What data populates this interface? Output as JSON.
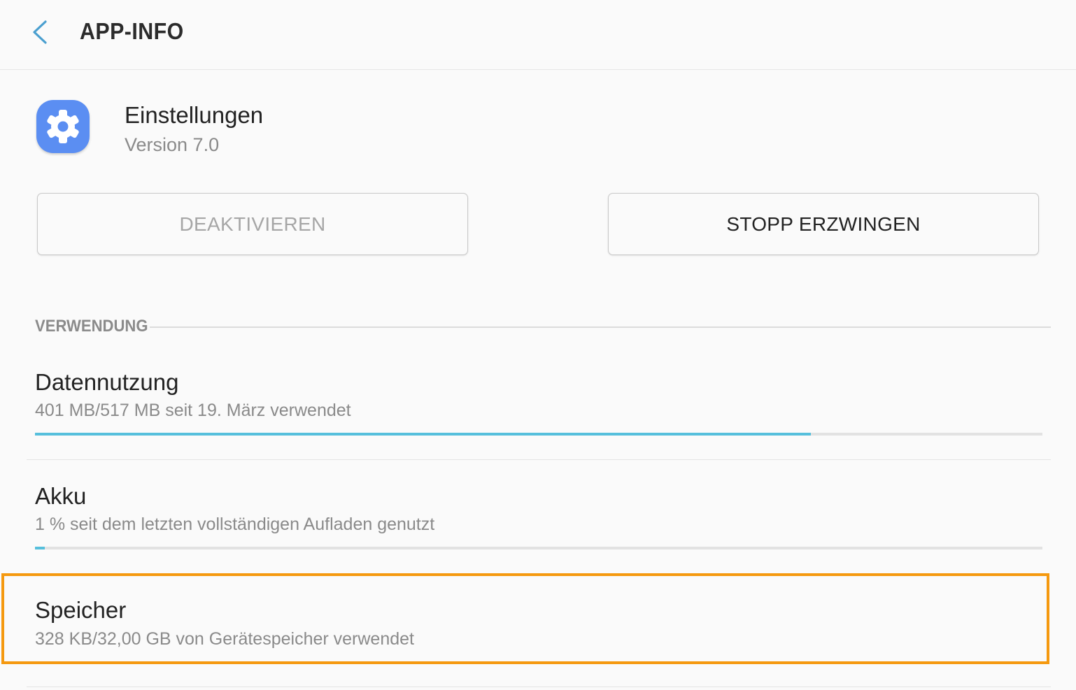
{
  "header": {
    "title": "APP-INFO",
    "back_icon": "chevron-left-icon",
    "accent": "#4a9fcf"
  },
  "app": {
    "name": "Einstellungen",
    "version": "Version 7.0",
    "icon": "gear-icon",
    "icon_color": "#5b8ef2"
  },
  "buttons": {
    "disable_label": "DEAKTIVIEREN",
    "force_stop_label": "STOPP ERZWINGEN"
  },
  "section": {
    "title": "VERWENDUNG"
  },
  "items": [
    {
      "title": "Datennutzung",
      "subtitle": "401 MB/517 MB seit 19. März verwendet",
      "progress": 0.77,
      "progress_color": "#56bfdc"
    },
    {
      "title": "Akku",
      "subtitle": "1 % seit dem letzten vollständigen Aufladen genutzt",
      "progress": 0.01,
      "progress_color": "#56bfdc"
    },
    {
      "title": "Speicher",
      "subtitle": "328 KB/32,00 GB von Gerätespeicher verwendet",
      "highlighted": true,
      "highlight_color": "#f5990f"
    }
  ]
}
